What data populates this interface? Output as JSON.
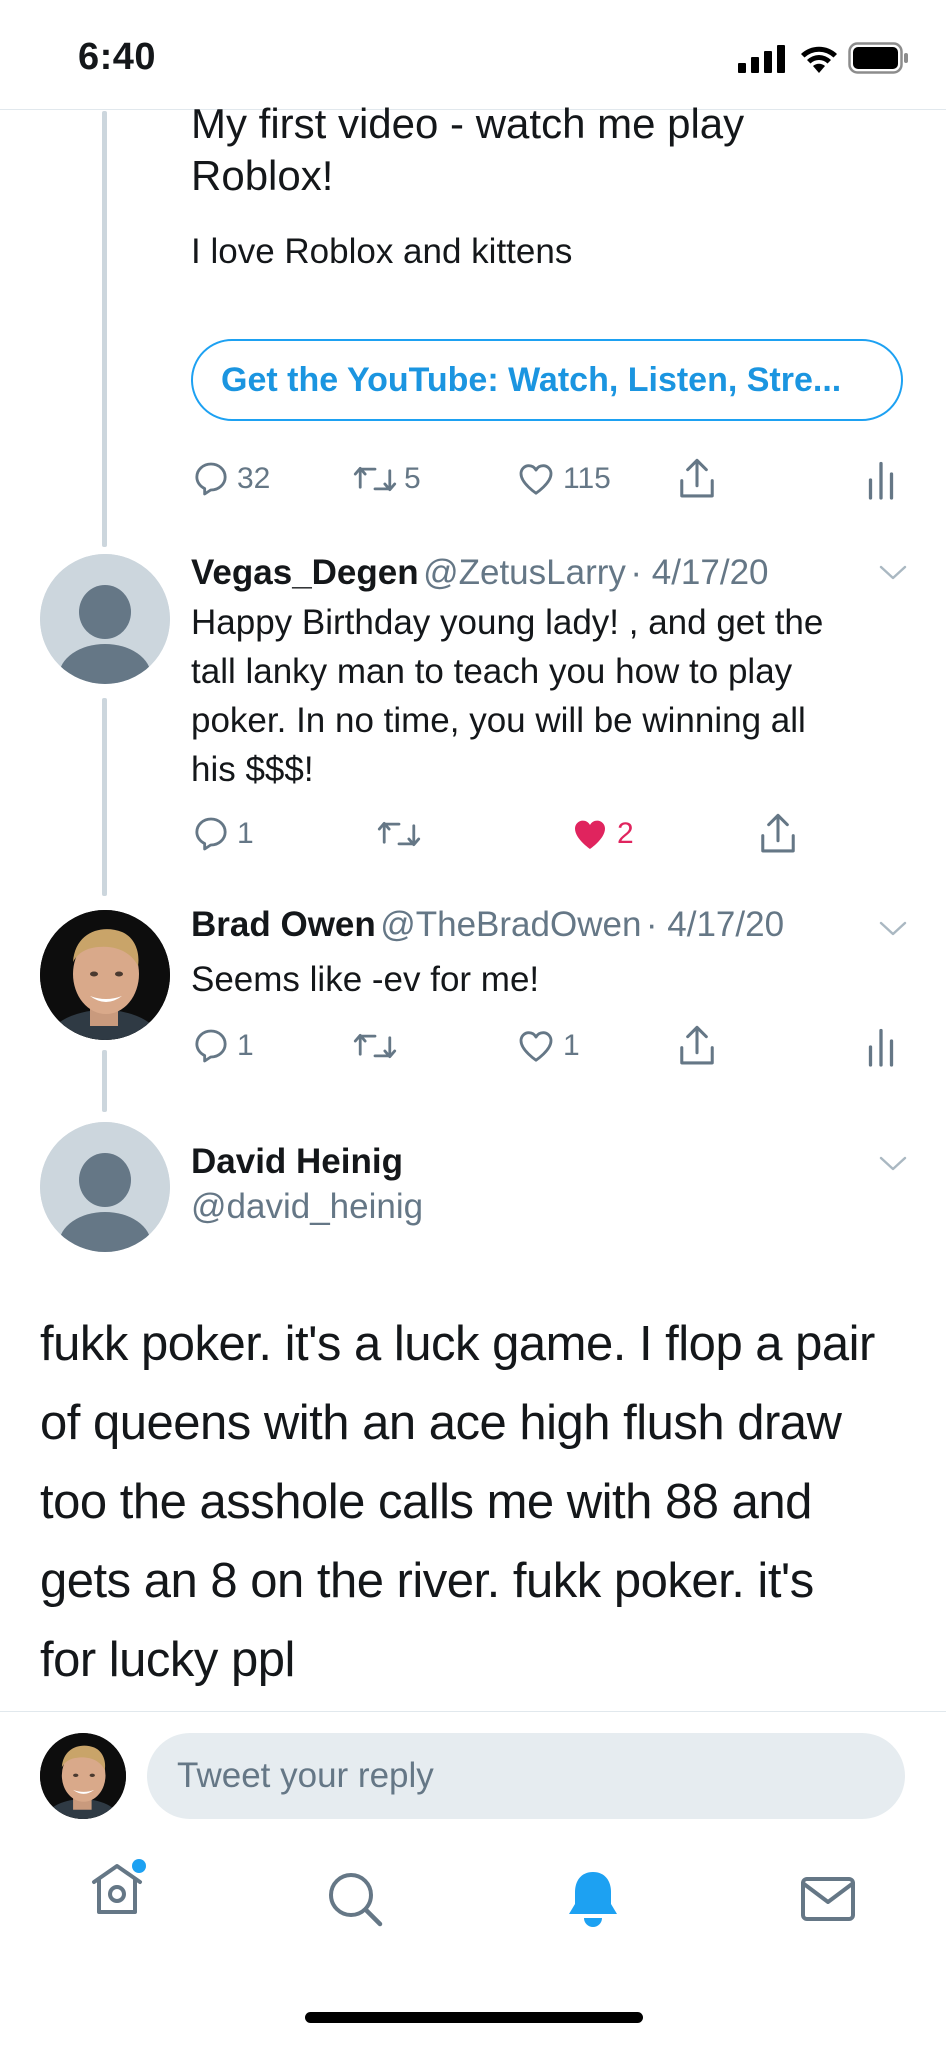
{
  "status_bar": {
    "time": "6:40"
  },
  "top_tweet": {
    "card_title": "My first video - watch me play Roblox!",
    "card_subtitle": "I love Roblox and kittens",
    "link_label": "Get the YouTube: Watch, Listen, Stre...",
    "replies": "32",
    "retweets": "5",
    "likes": "115"
  },
  "replies": [
    {
      "name": "Vegas_Degen",
      "handle": "@ZetusLarry",
      "date": "· 4/17/20",
      "lines": [
        "Happy Birthday young lady! , and get the",
        "tall lanky man to teach you how to play",
        "poker. In no time, you will be winning all",
        "his $$$!"
      ],
      "reply_count": "1",
      "retweet_count": "",
      "like_count": "2",
      "liked": true
    },
    {
      "name": "Brad Owen",
      "handle": "@TheBradOwen",
      "date": "· 4/17/20",
      "lines": [
        "Seems like -ev for me!"
      ],
      "reply_count": "1",
      "retweet_count": "",
      "like_count": "1",
      "liked": false
    }
  ],
  "main_tweet": {
    "name": "David Heinig",
    "handle": "@david_heinig",
    "lines": [
      "fukk poker. it's a luck game. I flop a pair",
      "of queens with an ace high flush draw",
      "too the asshole calls me with 88 and",
      "gets an 8 on the river. fukk poker. it's",
      "for lucky ppl"
    ]
  },
  "composer": {
    "placeholder": "Tweet your reply"
  },
  "tab_bar": {
    "items": [
      {
        "name": "home-icon",
        "active": false,
        "badge": true
      },
      {
        "name": "search-icon",
        "active": false,
        "badge": false
      },
      {
        "name": "notifications-icon",
        "active": true,
        "badge": false
      },
      {
        "name": "messages-icon",
        "active": false,
        "badge": false
      }
    ]
  },
  "colors": {
    "accent": "#1da1f2",
    "like": "#e0245e",
    "secondary_text": "#657786",
    "thread_line": "#ccd6dd"
  }
}
